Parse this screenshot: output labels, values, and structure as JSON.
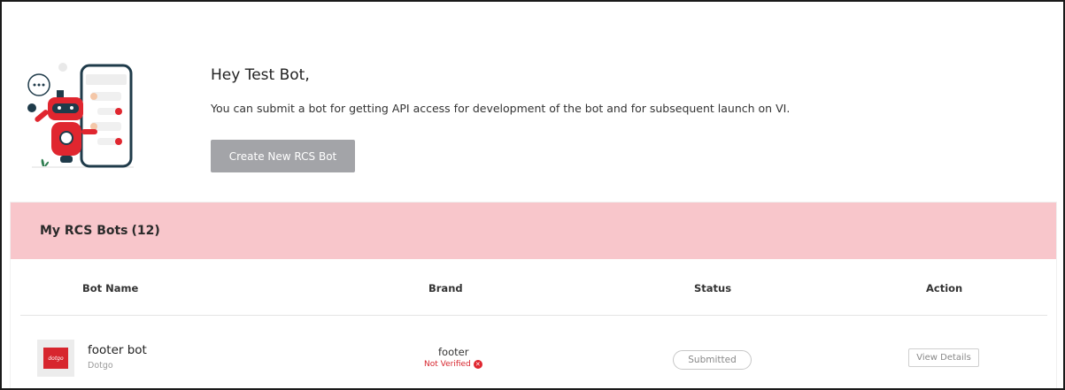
{
  "welcome": {
    "title": "Hey Test Bot,",
    "message": "You can submit a bot for getting API access for development of the bot and for subsequent launch on VI.",
    "create_button": "Create New RCS Bot"
  },
  "bots_section": {
    "title": "My RCS Bots",
    "count": "(12)"
  },
  "table": {
    "headers": {
      "bot_name": "Bot Name",
      "brand": "Brand",
      "status": "Status",
      "action": "Action"
    },
    "rows": [
      {
        "logo_text": "dotgo",
        "bot_name": "footer bot",
        "bot_sub": "Dotgo",
        "brand": "footer",
        "verification": "Not Verified",
        "status": "Submitted",
        "action": "View Details"
      }
    ]
  },
  "colors": {
    "section_bg": "#f8c6cb",
    "button_bg": "#a3a4a8",
    "error_red": "#d7262e"
  }
}
